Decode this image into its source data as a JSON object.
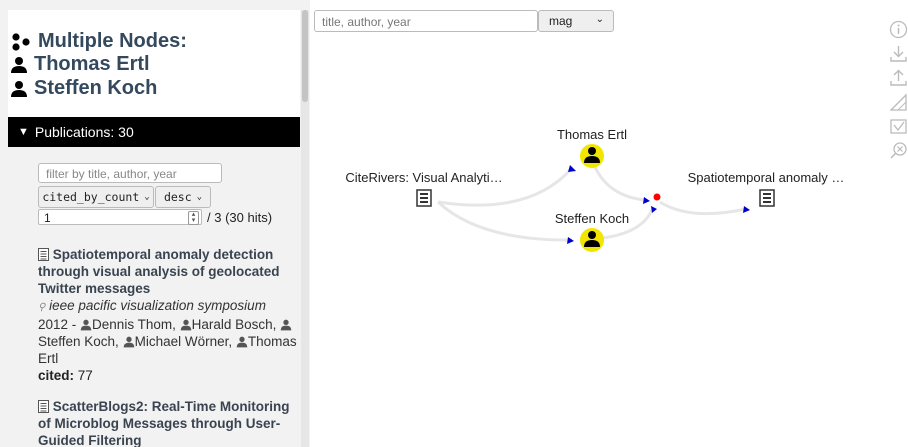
{
  "header": {
    "line1": "Multiple Nodes:",
    "line2": "Thomas Ertl",
    "line3": "Steffen Koch"
  },
  "publications_bar": {
    "label": "Publications: 30",
    "icon": "triangle-down-icon"
  },
  "filter": {
    "placeholder": "filter by title, author, year"
  },
  "sort": {
    "field": "cited_by_count",
    "order": "desc"
  },
  "paging": {
    "page": "1",
    "total": "/ 3 (30 hits)"
  },
  "publications": [
    {
      "title": "Spatiotemporal anomaly detection through visual analysis of geolocated Twitter messages",
      "venue": "ieee pacific visualization symposium",
      "year": "2012 -",
      "authors": [
        "Dennis Thom,",
        "Harald Bosch,",
        "Steffen Koch,",
        "Michael Wörner,",
        "Thomas Ertl"
      ],
      "cited_label": "cited:",
      "cited": "77"
    },
    {
      "title": "ScatterBlogs2: Real-Time Monitoring of Microblog Messages through User-Guided Filtering"
    }
  ],
  "search": {
    "placeholder": "title, author, year"
  },
  "source_select": {
    "value": "mag"
  },
  "graph": {
    "nodes": [
      {
        "id": "citerivers",
        "label": "CiteRivers: Visual Analyti…",
        "kind": "paper"
      },
      {
        "id": "ertl",
        "label": "Thomas Ertl",
        "kind": "author"
      },
      {
        "id": "koch",
        "label": "Steffen Koch",
        "kind": "author"
      },
      {
        "id": "spatio",
        "label": "Spatiotemporal anomaly …",
        "kind": "paper"
      }
    ],
    "colors": {
      "author_fill": "#f2e600",
      "junction": "#ff0000",
      "arrow": "#0000cc",
      "edge": "#e6e6e6"
    }
  },
  "toolbar": [
    "info-icon",
    "download-icon",
    "upload-icon",
    "measure-icon",
    "chart-check-icon",
    "search-x-icon"
  ]
}
